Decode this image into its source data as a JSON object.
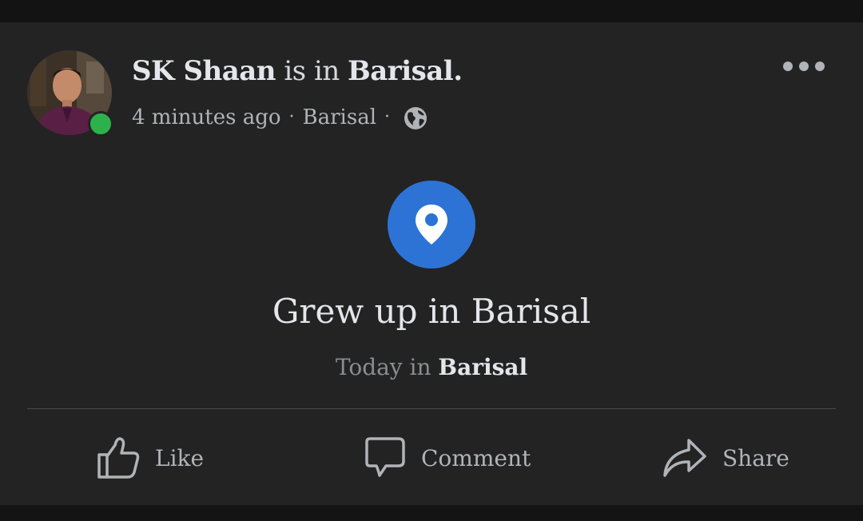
{
  "post": {
    "author": "SK Shaan",
    "verb": "is in",
    "place": "Barisal.",
    "time": "4 minutes ago",
    "location": "Barisal",
    "separator": "·",
    "privacy_icon": "globe-icon",
    "online": true
  },
  "life_event": {
    "icon": "location-pin-icon",
    "icon_color": "#2d73d6",
    "title": "Grew up in Barisal",
    "sub_prefix": "Today in",
    "sub_place": "Barisal"
  },
  "actions": {
    "like": "Like",
    "comment": "Comment",
    "share": "Share"
  },
  "colors": {
    "card_bg": "#232323",
    "page_bg": "#131313",
    "text_primary": "#e4e6eb",
    "text_secondary": "#b0b3b8",
    "online_green": "#2db24b"
  }
}
